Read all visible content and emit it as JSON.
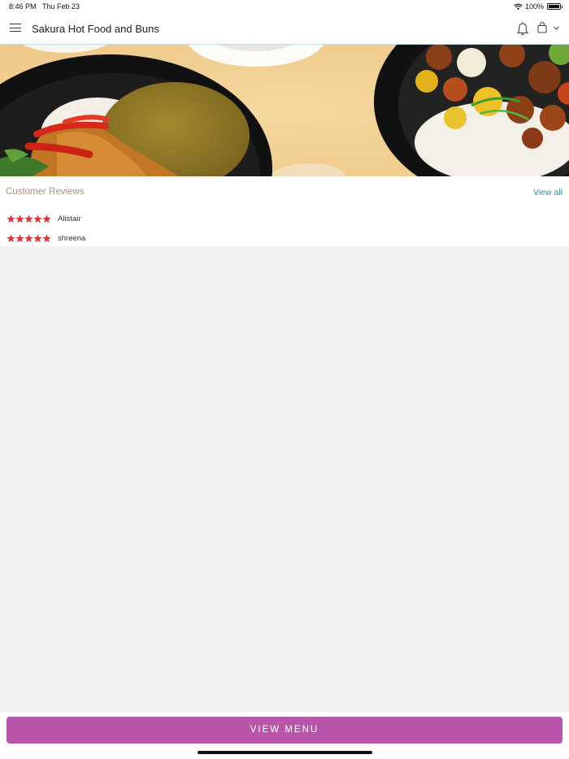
{
  "status_bar": {
    "time": "8:46 PM",
    "date": "Thu Feb 23",
    "battery": "100%"
  },
  "header": {
    "title": "Sakura Hot Food and Buns"
  },
  "reviews": {
    "title": "Customer Reviews",
    "view_all_label": "View all",
    "items": [
      {
        "name": "Alistair",
        "rating": 5
      },
      {
        "name": "shreena",
        "rating": 5
      }
    ]
  },
  "footer": {
    "button_label": "VIEW MENU"
  },
  "colors": {
    "accent": "#b956ab",
    "star": "#d9383f",
    "link": "#3a8aa8"
  }
}
